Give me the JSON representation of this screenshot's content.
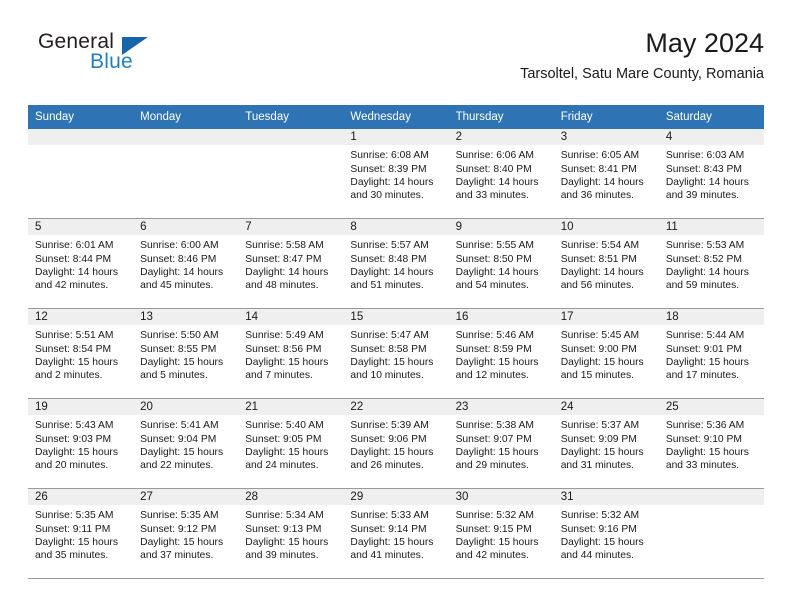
{
  "brand": {
    "name_top": "General",
    "name_bottom": "Blue",
    "accent_color": "#1f7fc4"
  },
  "header": {
    "title": "May 2024",
    "subtitle": "Tarsoltel, Satu Mare County, Romania"
  },
  "calendar": {
    "header_color": "#2e74b5",
    "weekdays": [
      "Sunday",
      "Monday",
      "Tuesday",
      "Wednesday",
      "Thursday",
      "Friday",
      "Saturday"
    ],
    "weeks": [
      [
        {
          "day": ""
        },
        {
          "day": ""
        },
        {
          "day": ""
        },
        {
          "day": "1",
          "sunrise": "Sunrise: 6:08 AM",
          "sunset": "Sunset: 8:39 PM",
          "daylight_1": "Daylight: 14 hours",
          "daylight_2": "and 30 minutes."
        },
        {
          "day": "2",
          "sunrise": "Sunrise: 6:06 AM",
          "sunset": "Sunset: 8:40 PM",
          "daylight_1": "Daylight: 14 hours",
          "daylight_2": "and 33 minutes."
        },
        {
          "day": "3",
          "sunrise": "Sunrise: 6:05 AM",
          "sunset": "Sunset: 8:41 PM",
          "daylight_1": "Daylight: 14 hours",
          "daylight_2": "and 36 minutes."
        },
        {
          "day": "4",
          "sunrise": "Sunrise: 6:03 AM",
          "sunset": "Sunset: 8:43 PM",
          "daylight_1": "Daylight: 14 hours",
          "daylight_2": "and 39 minutes."
        }
      ],
      [
        {
          "day": "5",
          "sunrise": "Sunrise: 6:01 AM",
          "sunset": "Sunset: 8:44 PM",
          "daylight_1": "Daylight: 14 hours",
          "daylight_2": "and 42 minutes."
        },
        {
          "day": "6",
          "sunrise": "Sunrise: 6:00 AM",
          "sunset": "Sunset: 8:46 PM",
          "daylight_1": "Daylight: 14 hours",
          "daylight_2": "and 45 minutes."
        },
        {
          "day": "7",
          "sunrise": "Sunrise: 5:58 AM",
          "sunset": "Sunset: 8:47 PM",
          "daylight_1": "Daylight: 14 hours",
          "daylight_2": "and 48 minutes."
        },
        {
          "day": "8",
          "sunrise": "Sunrise: 5:57 AM",
          "sunset": "Sunset: 8:48 PM",
          "daylight_1": "Daylight: 14 hours",
          "daylight_2": "and 51 minutes."
        },
        {
          "day": "9",
          "sunrise": "Sunrise: 5:55 AM",
          "sunset": "Sunset: 8:50 PM",
          "daylight_1": "Daylight: 14 hours",
          "daylight_2": "and 54 minutes."
        },
        {
          "day": "10",
          "sunrise": "Sunrise: 5:54 AM",
          "sunset": "Sunset: 8:51 PM",
          "daylight_1": "Daylight: 14 hours",
          "daylight_2": "and 56 minutes."
        },
        {
          "day": "11",
          "sunrise": "Sunrise: 5:53 AM",
          "sunset": "Sunset: 8:52 PM",
          "daylight_1": "Daylight: 14 hours",
          "daylight_2": "and 59 minutes."
        }
      ],
      [
        {
          "day": "12",
          "sunrise": "Sunrise: 5:51 AM",
          "sunset": "Sunset: 8:54 PM",
          "daylight_1": "Daylight: 15 hours",
          "daylight_2": "and 2 minutes."
        },
        {
          "day": "13",
          "sunrise": "Sunrise: 5:50 AM",
          "sunset": "Sunset: 8:55 PM",
          "daylight_1": "Daylight: 15 hours",
          "daylight_2": "and 5 minutes."
        },
        {
          "day": "14",
          "sunrise": "Sunrise: 5:49 AM",
          "sunset": "Sunset: 8:56 PM",
          "daylight_1": "Daylight: 15 hours",
          "daylight_2": "and 7 minutes."
        },
        {
          "day": "15",
          "sunrise": "Sunrise: 5:47 AM",
          "sunset": "Sunset: 8:58 PM",
          "daylight_1": "Daylight: 15 hours",
          "daylight_2": "and 10 minutes."
        },
        {
          "day": "16",
          "sunrise": "Sunrise: 5:46 AM",
          "sunset": "Sunset: 8:59 PM",
          "daylight_1": "Daylight: 15 hours",
          "daylight_2": "and 12 minutes."
        },
        {
          "day": "17",
          "sunrise": "Sunrise: 5:45 AM",
          "sunset": "Sunset: 9:00 PM",
          "daylight_1": "Daylight: 15 hours",
          "daylight_2": "and 15 minutes."
        },
        {
          "day": "18",
          "sunrise": "Sunrise: 5:44 AM",
          "sunset": "Sunset: 9:01 PM",
          "daylight_1": "Daylight: 15 hours",
          "daylight_2": "and 17 minutes."
        }
      ],
      [
        {
          "day": "19",
          "sunrise": "Sunrise: 5:43 AM",
          "sunset": "Sunset: 9:03 PM",
          "daylight_1": "Daylight: 15 hours",
          "daylight_2": "and 20 minutes."
        },
        {
          "day": "20",
          "sunrise": "Sunrise: 5:41 AM",
          "sunset": "Sunset: 9:04 PM",
          "daylight_1": "Daylight: 15 hours",
          "daylight_2": "and 22 minutes."
        },
        {
          "day": "21",
          "sunrise": "Sunrise: 5:40 AM",
          "sunset": "Sunset: 9:05 PM",
          "daylight_1": "Daylight: 15 hours",
          "daylight_2": "and 24 minutes."
        },
        {
          "day": "22",
          "sunrise": "Sunrise: 5:39 AM",
          "sunset": "Sunset: 9:06 PM",
          "daylight_1": "Daylight: 15 hours",
          "daylight_2": "and 26 minutes."
        },
        {
          "day": "23",
          "sunrise": "Sunrise: 5:38 AM",
          "sunset": "Sunset: 9:07 PM",
          "daylight_1": "Daylight: 15 hours",
          "daylight_2": "and 29 minutes."
        },
        {
          "day": "24",
          "sunrise": "Sunrise: 5:37 AM",
          "sunset": "Sunset: 9:09 PM",
          "daylight_1": "Daylight: 15 hours",
          "daylight_2": "and 31 minutes."
        },
        {
          "day": "25",
          "sunrise": "Sunrise: 5:36 AM",
          "sunset": "Sunset: 9:10 PM",
          "daylight_1": "Daylight: 15 hours",
          "daylight_2": "and 33 minutes."
        }
      ],
      [
        {
          "day": "26",
          "sunrise": "Sunrise: 5:35 AM",
          "sunset": "Sunset: 9:11 PM",
          "daylight_1": "Daylight: 15 hours",
          "daylight_2": "and 35 minutes."
        },
        {
          "day": "27",
          "sunrise": "Sunrise: 5:35 AM",
          "sunset": "Sunset: 9:12 PM",
          "daylight_1": "Daylight: 15 hours",
          "daylight_2": "and 37 minutes."
        },
        {
          "day": "28",
          "sunrise": "Sunrise: 5:34 AM",
          "sunset": "Sunset: 9:13 PM",
          "daylight_1": "Daylight: 15 hours",
          "daylight_2": "and 39 minutes."
        },
        {
          "day": "29",
          "sunrise": "Sunrise: 5:33 AM",
          "sunset": "Sunset: 9:14 PM",
          "daylight_1": "Daylight: 15 hours",
          "daylight_2": "and 41 minutes."
        },
        {
          "day": "30",
          "sunrise": "Sunrise: 5:32 AM",
          "sunset": "Sunset: 9:15 PM",
          "daylight_1": "Daylight: 15 hours",
          "daylight_2": "and 42 minutes."
        },
        {
          "day": "31",
          "sunrise": "Sunrise: 5:32 AM",
          "sunset": "Sunset: 9:16 PM",
          "daylight_1": "Daylight: 15 hours",
          "daylight_2": "and 44 minutes."
        },
        {
          "day": ""
        }
      ]
    ]
  }
}
